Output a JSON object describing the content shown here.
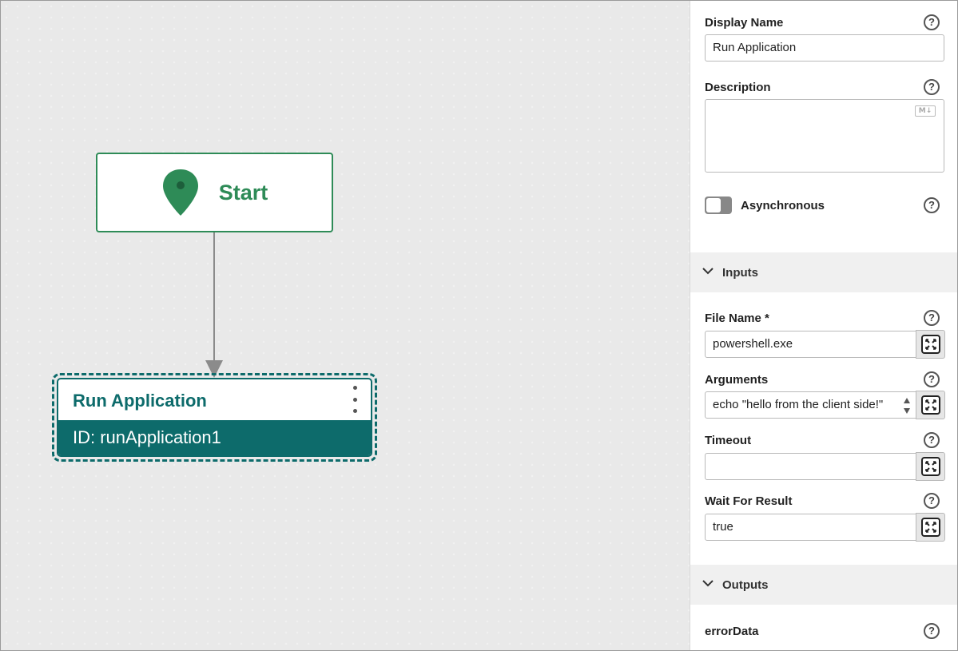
{
  "canvas": {
    "start_node": {
      "label": "Start",
      "icon": "map-pin-icon"
    },
    "activity": {
      "title": "Run Application",
      "id_text": "ID: runApplication1",
      "menu_icon": "kebab-menu-icon"
    }
  },
  "panel": {
    "display_name": {
      "label": "Display Name",
      "value": "Run Application"
    },
    "description": {
      "label": "Description",
      "value": "",
      "badge": "M↓"
    },
    "asynchronous": {
      "label": "Asynchronous",
      "on": false
    },
    "inputs_section": {
      "label": "Inputs",
      "expanded": true
    },
    "file_name": {
      "label": "File Name",
      "required_mark": "*",
      "value": "powershell.exe"
    },
    "arguments": {
      "label": "Arguments",
      "value": "echo \"hello from the client side!\""
    },
    "timeout": {
      "label": "Timeout",
      "value": ""
    },
    "wait_for_result": {
      "label": "Wait For Result",
      "value": "true"
    },
    "outputs_section": {
      "label": "Outputs",
      "expanded": true
    },
    "error_data": {
      "label": "errorData"
    },
    "help_glyph": "?"
  },
  "colors": {
    "start_green": "#2e8b57",
    "activity_teal": "#0d6b6b",
    "connector": "#8b8b8b"
  }
}
